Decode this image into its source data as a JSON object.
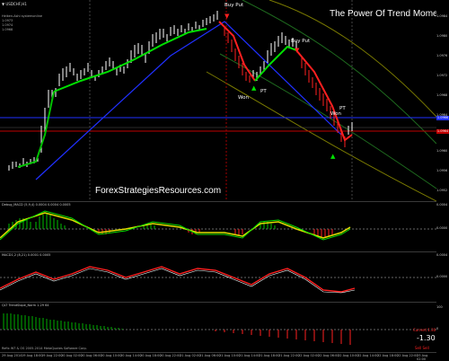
{
  "main": {
    "symbol_line": "▼ USDCHF,H1",
    "info_lines": [
      "Heiken-Ashi systemonline",
      "1.0973",
      "1.0974",
      "1.0968"
    ],
    "title": "The Power Of Trend Momentum",
    "watermark": "ForexStrategiesResources.com",
    "annotations": [
      "Buy Put",
      "Buy Put",
      "PT",
      "Won",
      "PT",
      "Won"
    ]
  },
  "sub1": {
    "label": "Debug_MACD (5,9,4) 0.0004 0.0004 0.0005"
  },
  "sub2": {
    "label": "MACD1,2 (8,21) 0.0001 0.0005"
  },
  "sub3": {
    "label": "QLT TrendSlope_Norm 1.29 64",
    "footer": "Refix WT & OS 2005-2014 MetaQuotes Software Corp.",
    "val_top": "Current 1.30",
    "val_big": "-1.30",
    "val_bottom": "Sell Sell"
  },
  "price_axis": [
    "1.0984",
    "1.0980",
    "1.0976",
    "1.0972",
    "1.0968",
    "1.0964",
    "1.0960",
    "1.0956",
    "1.0952"
  ],
  "sub_axis": [
    "0.0004",
    "0.0000",
    "0.0004",
    "0.0000",
    "100",
    "0"
  ],
  "price_tags": {
    "current": "1.0966",
    "red": "1.0964"
  },
  "time_axis": [
    "29 Aug 2014",
    "19 Aug 18:00",
    "19 Aug 22:00",
    "20 Aug 02:00",
    "20 Aug 06:00",
    "20 Aug 10:00",
    "20 Aug 14:00",
    "20 Aug 18:00",
    "20 Aug 22:00",
    "21 Aug 02:00",
    "21 Aug 06:00",
    "21 Aug 10:00",
    "21 Aug 14:00",
    "21 Aug 18:00",
    "21 Aug 22:00",
    "22 Aug 02:00",
    "22 Aug 06:00",
    "22 Aug 10:00",
    "22 Aug 14:00",
    "22 Aug 18:00",
    "22 Aug 22:00",
    "23 Aug 02:00"
  ],
  "colors": {
    "up": "#ffffff",
    "green": "#00e000",
    "red": "#ff2020",
    "blue": "#2030ff",
    "yellow": "#e0e000",
    "olive": "#7a7a00",
    "darkgreen": "#1e6a1e"
  }
}
